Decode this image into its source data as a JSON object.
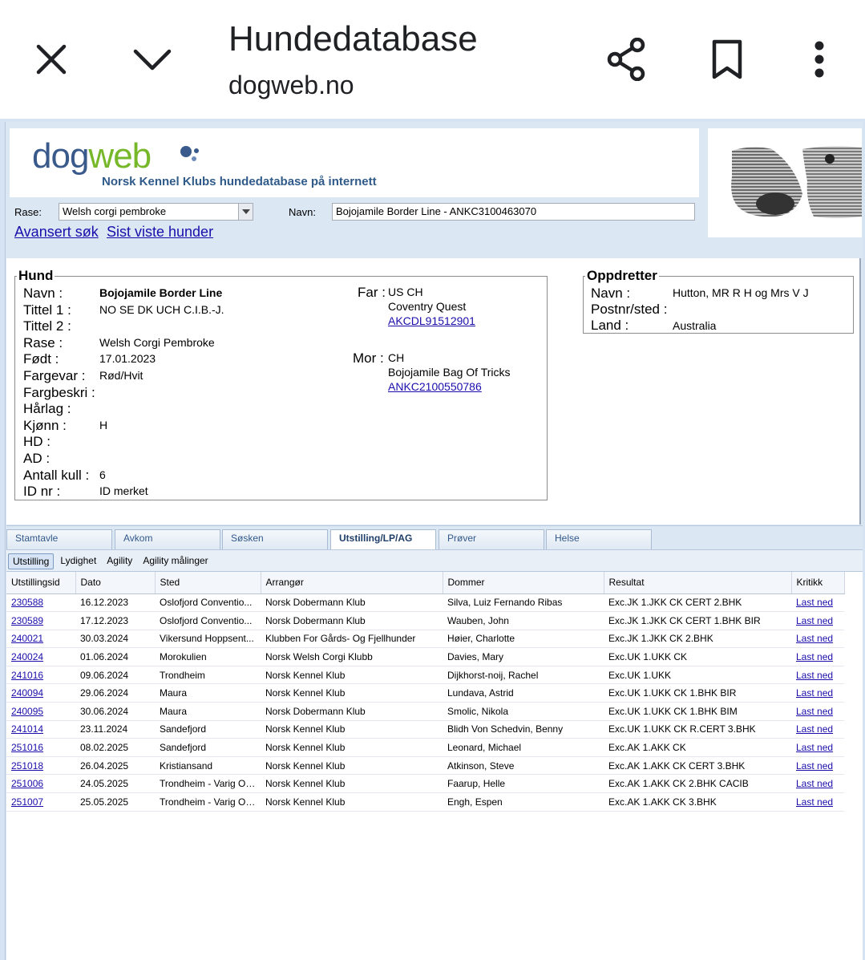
{
  "browser": {
    "title": "Hundedatabase",
    "url": "dogweb.no",
    "icons": [
      "close-icon",
      "chevron-down-icon",
      "share-icon",
      "bookmark-icon",
      "more-vert-icon"
    ]
  },
  "header": {
    "logo_dog": "dog",
    "logo_web": "web",
    "subtitle": "Norsk Kennel Klubs hundedatabase på internett"
  },
  "search": {
    "rase_label": "Rase:",
    "rase_value": "Welsh corgi pembroke",
    "navn_label": "Navn:",
    "navn_value": "Bojojamile Border Line - ANKC3100463070",
    "link_advanced": "Avansert søk",
    "link_recent": "Sist viste hunder"
  },
  "hund": {
    "legend": "Hund",
    "fields": [
      {
        "label": "Navn :",
        "value": "Bojojamile Border Line",
        "bold": true
      },
      {
        "label": "Tittel 1 :",
        "value": "NO SE DK UCH C.I.B.-J."
      },
      {
        "label": "Tittel 2 :",
        "value": ""
      },
      {
        "label": "Rase :",
        "value": "Welsh Corgi Pembroke"
      },
      {
        "label": "Født :",
        "value": "17.01.2023"
      },
      {
        "label": "Fargevar :",
        "value": "Rød/Hvit"
      },
      {
        "label": "Fargbeskri :",
        "value": ""
      },
      {
        "label": "Hårlag :",
        "value": ""
      },
      {
        "label": "Kjønn :",
        "value": "H"
      },
      {
        "label": "HD :",
        "value": ""
      },
      {
        "label": "AD :",
        "value": ""
      },
      {
        "label": "Antall kull :",
        "value": "6"
      },
      {
        "label": "ID nr :",
        "value": "ID merket"
      }
    ],
    "far": {
      "label": "Far :",
      "title": "US CH",
      "name": "Coventry Quest",
      "reg": "AKCDL91512901"
    },
    "mor": {
      "label": "Mor :",
      "title": "CH",
      "name": "Bojojamile Bag Of Tricks",
      "reg": "ANKC2100550786"
    }
  },
  "oppdretter": {
    "legend": "Oppdretter",
    "navn_label": "Navn :",
    "navn_value": "Hutton, MR R H og Mrs V J",
    "postnr_label": "Postnr/sted :",
    "postnr_value": "",
    "land_label": "Land :",
    "land_value": "Australia"
  },
  "tabs": [
    "Stamtavle",
    "Avkom",
    "Søsken",
    "Utstilling/LP/AG",
    "Prøver",
    "Helse"
  ],
  "active_tab": "Utstilling/LP/AG",
  "subtabs": [
    "Utstilling",
    "Lydighet",
    "Agility",
    "Agility målinger"
  ],
  "active_subtab": "Utstilling",
  "table": {
    "columns": [
      "Utstillingsid",
      "Dato",
      "Sted",
      "Arrangør",
      "Dommer",
      "Resultat",
      "Kritikk"
    ],
    "rows": [
      [
        "230588",
        "16.12.2023",
        "Oslofjord Conventio...",
        "Norsk Dobermann Klub",
        "Silva, Luiz Fernando Ribas",
        "Exc.JK 1.JKK CK CERT 2.BHK",
        "Last ned"
      ],
      [
        "230589",
        "17.12.2023",
        "Oslofjord Conventio...",
        "Norsk Dobermann Klub",
        "Wauben, John",
        "Exc.JK 1.JKK CK CERT 1.BHK BIR",
        "Last ned"
      ],
      [
        "240021",
        "30.03.2024",
        "Vikersund Hoppsent...",
        "Klubben For Gårds- Og Fjellhunder",
        "Høier, Charlotte",
        "Exc.JK 1.JKK CK 2.BHK",
        "Last ned"
      ],
      [
        "240024",
        "01.06.2024",
        "Morokulien",
        "Norsk Welsh Corgi Klubb",
        "Davies, Mary",
        "Exc.UK 1.UKK CK",
        "Last ned"
      ],
      [
        "241016",
        "09.06.2024",
        "Trondheim",
        "Norsk Kennel Klub",
        "Dijkhorst-noij, Rachel",
        "Exc.UK 1.UKK",
        "Last ned"
      ],
      [
        "240094",
        "29.06.2024",
        "Maura",
        "Norsk Kennel Klub",
        "Lundava, Astrid",
        "Exc.UK 1.UKK CK 1.BHK BIR",
        "Last ned"
      ],
      [
        "240095",
        "30.06.2024",
        "Maura",
        "Norsk Dobermann Klub",
        "Smolic, Nikola",
        "Exc.UK 1.UKK CK 1.BHK BIM",
        "Last ned"
      ],
      [
        "241014",
        "23.11.2024",
        "Sandefjord",
        "Norsk Kennel Klub",
        "Blidh Von Schedvin, Benny",
        "Exc.UK 1.UKK CK R.CERT 3.BHK",
        "Last ned"
      ],
      [
        "251016",
        "08.02.2025",
        "Sandefjord",
        "Norsk Kennel Klub",
        "Leonard, Michael",
        "Exc.AK 1.AKK CK",
        "Last ned"
      ],
      [
        "251018",
        "26.04.2025",
        "Kristiansand",
        "Norsk Kennel Klub",
        "Atkinson, Steve",
        "Exc.AK 1.AKK CK CERT 3.BHK",
        "Last ned"
      ],
      [
        "251006",
        "24.05.2025",
        "Trondheim - Varig Or...",
        "Norsk Kennel Klub",
        "Faarup, Helle",
        "Exc.AK 1.AKK CK 2.BHK CACIB",
        "Last ned"
      ],
      [
        "251007",
        "25.05.2025",
        "Trondheim - Varig Or...",
        "Norsk Kennel Klub",
        "Engh, Espen",
        "Exc.AK 1.AKK CK 3.BHK",
        "Last ned"
      ]
    ]
  }
}
